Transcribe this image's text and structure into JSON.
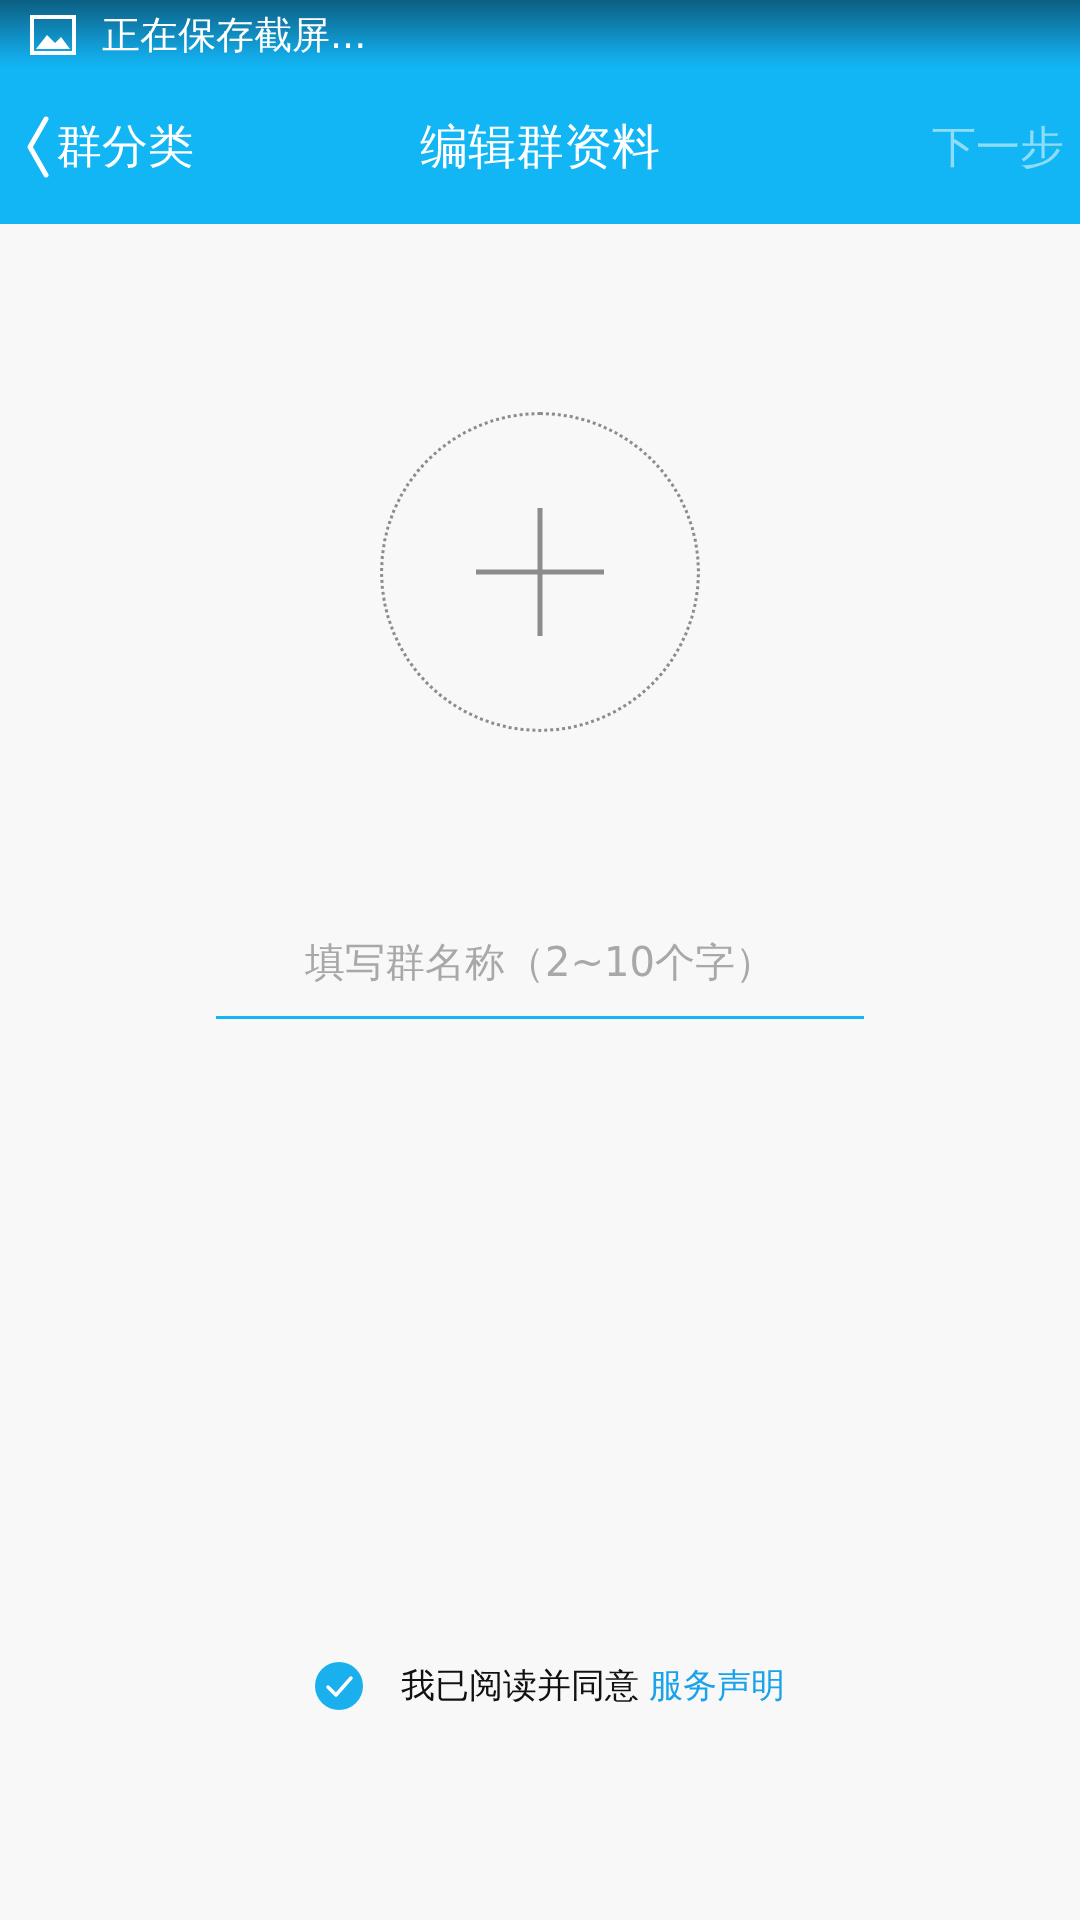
{
  "status_bar": {
    "notification": "正在保存截屏..."
  },
  "app_bar": {
    "back_label": "群分类",
    "title": "编辑群资料",
    "next": {
      "label": "下一步",
      "disabled": true
    }
  },
  "avatar_upload": {
    "kind": "add"
  },
  "name_field": {
    "placeholder": "填写群名称（2~10个字）"
  },
  "agreement": {
    "checked": true,
    "text": "我已阅读并同意",
    "link": "服务声明"
  }
}
